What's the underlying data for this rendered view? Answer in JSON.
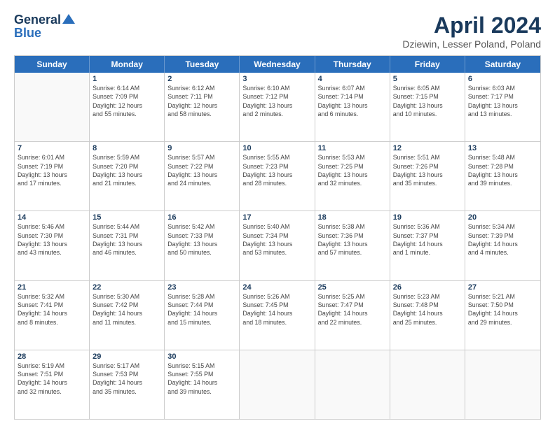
{
  "header": {
    "logo_line1": "General",
    "logo_line2": "Blue",
    "title": "April 2024",
    "subtitle": "Dziewin, Lesser Poland, Poland"
  },
  "days_of_week": [
    "Sunday",
    "Monday",
    "Tuesday",
    "Wednesday",
    "Thursday",
    "Friday",
    "Saturday"
  ],
  "weeks": [
    [
      {
        "day": "",
        "info": ""
      },
      {
        "day": "1",
        "info": "Sunrise: 6:14 AM\nSunset: 7:09 PM\nDaylight: 12 hours\nand 55 minutes."
      },
      {
        "day": "2",
        "info": "Sunrise: 6:12 AM\nSunset: 7:11 PM\nDaylight: 12 hours\nand 58 minutes."
      },
      {
        "day": "3",
        "info": "Sunrise: 6:10 AM\nSunset: 7:12 PM\nDaylight: 13 hours\nand 2 minutes."
      },
      {
        "day": "4",
        "info": "Sunrise: 6:07 AM\nSunset: 7:14 PM\nDaylight: 13 hours\nand 6 minutes."
      },
      {
        "day": "5",
        "info": "Sunrise: 6:05 AM\nSunset: 7:15 PM\nDaylight: 13 hours\nand 10 minutes."
      },
      {
        "day": "6",
        "info": "Sunrise: 6:03 AM\nSunset: 7:17 PM\nDaylight: 13 hours\nand 13 minutes."
      }
    ],
    [
      {
        "day": "7",
        "info": "Sunrise: 6:01 AM\nSunset: 7:19 PM\nDaylight: 13 hours\nand 17 minutes."
      },
      {
        "day": "8",
        "info": "Sunrise: 5:59 AM\nSunset: 7:20 PM\nDaylight: 13 hours\nand 21 minutes."
      },
      {
        "day": "9",
        "info": "Sunrise: 5:57 AM\nSunset: 7:22 PM\nDaylight: 13 hours\nand 24 minutes."
      },
      {
        "day": "10",
        "info": "Sunrise: 5:55 AM\nSunset: 7:23 PM\nDaylight: 13 hours\nand 28 minutes."
      },
      {
        "day": "11",
        "info": "Sunrise: 5:53 AM\nSunset: 7:25 PM\nDaylight: 13 hours\nand 32 minutes."
      },
      {
        "day": "12",
        "info": "Sunrise: 5:51 AM\nSunset: 7:26 PM\nDaylight: 13 hours\nand 35 minutes."
      },
      {
        "day": "13",
        "info": "Sunrise: 5:48 AM\nSunset: 7:28 PM\nDaylight: 13 hours\nand 39 minutes."
      }
    ],
    [
      {
        "day": "14",
        "info": "Sunrise: 5:46 AM\nSunset: 7:30 PM\nDaylight: 13 hours\nand 43 minutes."
      },
      {
        "day": "15",
        "info": "Sunrise: 5:44 AM\nSunset: 7:31 PM\nDaylight: 13 hours\nand 46 minutes."
      },
      {
        "day": "16",
        "info": "Sunrise: 5:42 AM\nSunset: 7:33 PM\nDaylight: 13 hours\nand 50 minutes."
      },
      {
        "day": "17",
        "info": "Sunrise: 5:40 AM\nSunset: 7:34 PM\nDaylight: 13 hours\nand 53 minutes."
      },
      {
        "day": "18",
        "info": "Sunrise: 5:38 AM\nSunset: 7:36 PM\nDaylight: 13 hours\nand 57 minutes."
      },
      {
        "day": "19",
        "info": "Sunrise: 5:36 AM\nSunset: 7:37 PM\nDaylight: 14 hours\nand 1 minute."
      },
      {
        "day": "20",
        "info": "Sunrise: 5:34 AM\nSunset: 7:39 PM\nDaylight: 14 hours\nand 4 minutes."
      }
    ],
    [
      {
        "day": "21",
        "info": "Sunrise: 5:32 AM\nSunset: 7:41 PM\nDaylight: 14 hours\nand 8 minutes."
      },
      {
        "day": "22",
        "info": "Sunrise: 5:30 AM\nSunset: 7:42 PM\nDaylight: 14 hours\nand 11 minutes."
      },
      {
        "day": "23",
        "info": "Sunrise: 5:28 AM\nSunset: 7:44 PM\nDaylight: 14 hours\nand 15 minutes."
      },
      {
        "day": "24",
        "info": "Sunrise: 5:26 AM\nSunset: 7:45 PM\nDaylight: 14 hours\nand 18 minutes."
      },
      {
        "day": "25",
        "info": "Sunrise: 5:25 AM\nSunset: 7:47 PM\nDaylight: 14 hours\nand 22 minutes."
      },
      {
        "day": "26",
        "info": "Sunrise: 5:23 AM\nSunset: 7:48 PM\nDaylight: 14 hours\nand 25 minutes."
      },
      {
        "day": "27",
        "info": "Sunrise: 5:21 AM\nSunset: 7:50 PM\nDaylight: 14 hours\nand 29 minutes."
      }
    ],
    [
      {
        "day": "28",
        "info": "Sunrise: 5:19 AM\nSunset: 7:51 PM\nDaylight: 14 hours\nand 32 minutes."
      },
      {
        "day": "29",
        "info": "Sunrise: 5:17 AM\nSunset: 7:53 PM\nDaylight: 14 hours\nand 35 minutes."
      },
      {
        "day": "30",
        "info": "Sunrise: 5:15 AM\nSunset: 7:55 PM\nDaylight: 14 hours\nand 39 minutes."
      },
      {
        "day": "",
        "info": ""
      },
      {
        "day": "",
        "info": ""
      },
      {
        "day": "",
        "info": ""
      },
      {
        "day": "",
        "info": ""
      }
    ]
  ]
}
